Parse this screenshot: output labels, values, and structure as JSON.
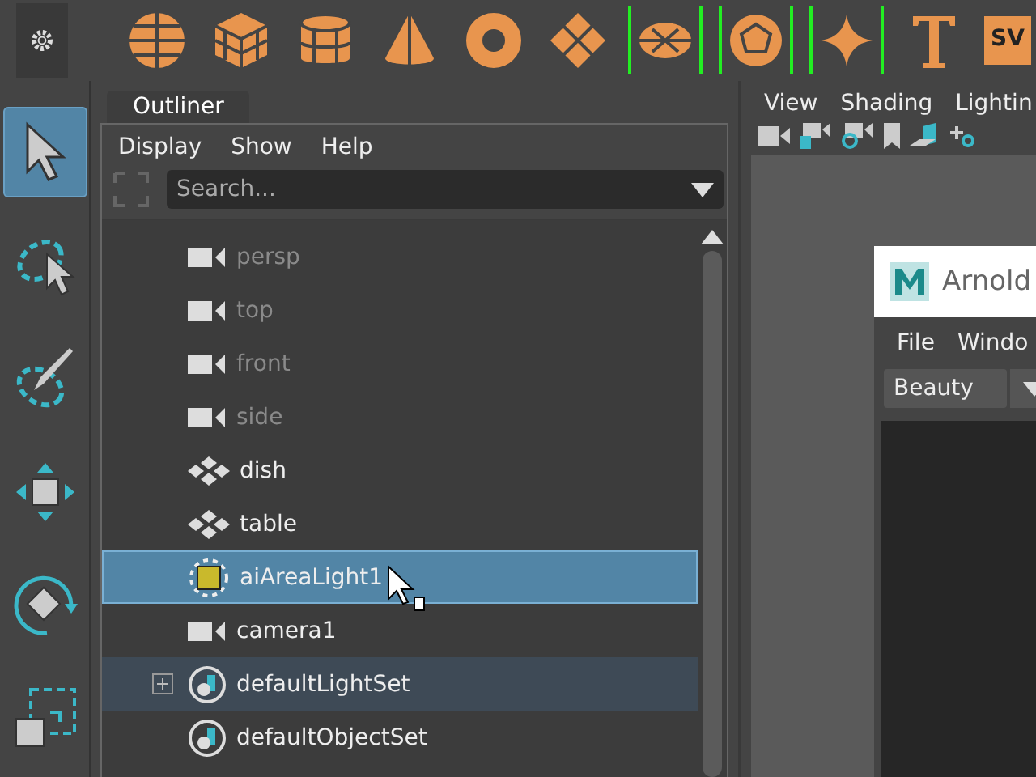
{
  "shelf": {
    "tools": [
      {
        "kind": "sphere"
      },
      {
        "kind": "cube"
      },
      {
        "kind": "cylinder"
      },
      {
        "kind": "cone"
      },
      {
        "kind": "torus"
      },
      {
        "kind": "plane"
      },
      {
        "kind": "disc",
        "bracketed": true
      },
      {
        "kind": "poly",
        "bracketed": true
      },
      {
        "kind": "star",
        "bracketed": true
      },
      {
        "kind": "text"
      }
    ],
    "svg_label": "SV"
  },
  "toolbox": [
    {
      "kind": "select",
      "selected": true
    },
    {
      "kind": "lasso",
      "selected": false
    },
    {
      "kind": "paint",
      "selected": false
    },
    {
      "kind": "move",
      "selected": false
    },
    {
      "kind": "rotate",
      "selected": false
    },
    {
      "kind": "scale",
      "selected": false
    }
  ],
  "outliner": {
    "tab": "Outliner",
    "menu": [
      "Display",
      "Show",
      "Help"
    ],
    "search": {
      "placeholder": "Search..."
    },
    "items": [
      {
        "name": "persp",
        "kind": "camera",
        "dimmed": true,
        "selected": false
      },
      {
        "name": "top",
        "kind": "camera",
        "dimmed": true,
        "selected": false
      },
      {
        "name": "front",
        "kind": "camera",
        "dimmed": true,
        "selected": false
      },
      {
        "name": "side",
        "kind": "camera",
        "dimmed": true,
        "selected": false
      },
      {
        "name": "dish",
        "kind": "mesh",
        "dimmed": false,
        "selected": false
      },
      {
        "name": "table",
        "kind": "mesh",
        "dimmed": false,
        "selected": false
      },
      {
        "name": "aiAreaLight1",
        "kind": "light",
        "dimmed": false,
        "selected": true
      },
      {
        "name": "camera1",
        "kind": "camera",
        "dimmed": false,
        "selected": false
      },
      {
        "name": "defaultLightSet",
        "kind": "set",
        "dimmed": false,
        "selected": false,
        "highlighted": true,
        "expandable": true
      },
      {
        "name": "defaultObjectSet",
        "kind": "set",
        "dimmed": false,
        "selected": false
      }
    ]
  },
  "viewport": {
    "menu": [
      "View",
      "Shading",
      "Lightin"
    ],
    "arnold_window": {
      "title": "Arnold",
      "menu": [
        "File",
        "Windo"
      ],
      "dropdown": "Beauty"
    }
  }
}
